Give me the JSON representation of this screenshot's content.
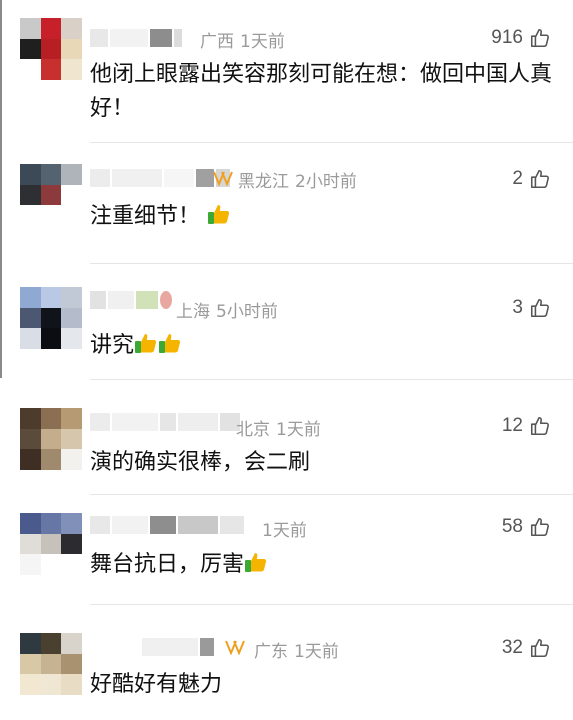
{
  "comments": [
    {
      "location": "广西",
      "time": "1天前",
      "likes": "916",
      "text": "他闭上眼露出笑容那刻可能在想：做回中国人真好！",
      "avatar_colors": [
        "#c9c9c9",
        "#c8202a",
        "#d9d0c8",
        "#1f1f1f",
        "#b81f24",
        "#e8d8b8",
        "#ffffff",
        "#c83030",
        "#f0e6d0"
      ]
    },
    {
      "location": "黑龙江",
      "time": "2小时前",
      "likes": "2",
      "text": "注重细节！",
      "emoji_count": 1,
      "avatar_colors": [
        "#3c4a57",
        "#556370",
        "#aeb4ba",
        "#2e2f33",
        "#8c3a3c",
        "#ffffff",
        "#ffffff",
        "#ffffff",
        "#ffffff"
      ]
    },
    {
      "location": "上海",
      "time": "5小时前",
      "likes": "3",
      "text": "讲究",
      "emoji_count": 2,
      "avatar_colors": [
        "#8fa9d2",
        "#b9c8e4",
        "#c2c9d6",
        "#4c5872",
        "#10131a",
        "#b4bccb",
        "#d8dde6",
        "#0b0d12",
        "#e4e7ec"
      ]
    },
    {
      "location": "北京",
      "time": "1天前",
      "likes": "12",
      "text": "演的确实很棒，会二刷",
      "avatar_colors": [
        "#4d3b2c",
        "#8a6f52",
        "#b59a74",
        "#5b4b3b",
        "#c3ad8c",
        "#d6c6ab",
        "#3e2e24",
        "#9f8a6e",
        "#f3f1ee"
      ]
    },
    {
      "location": "",
      "time": "1天前",
      "likes": "58",
      "text": "舞台抗日，厉害",
      "emoji_count": 1,
      "avatar_colors": [
        "#4a5a8c",
        "#6676a5",
        "#8090b8",
        "#e0ddd8",
        "#c6c2bb",
        "#2c2c30",
        "#f5f5f5",
        "#ffffff",
        "#ffffff"
      ]
    },
    {
      "location": "广东",
      "time": "1天前",
      "likes": "32",
      "text": "好酷好有魅力",
      "avatar_colors": [
        "#2e3a40",
        "#4a4030",
        "#d8d4cc",
        "#d8c8a6",
        "#c6b392",
        "#a89270",
        "#f2e8d2",
        "#efe6d4",
        "#e8dcc4"
      ]
    }
  ],
  "colors": {
    "meta": "#9a9a9a",
    "text": "#111111",
    "emoji_thumb": "#f5b400",
    "emoji_sleeve": "#3aaa35"
  }
}
